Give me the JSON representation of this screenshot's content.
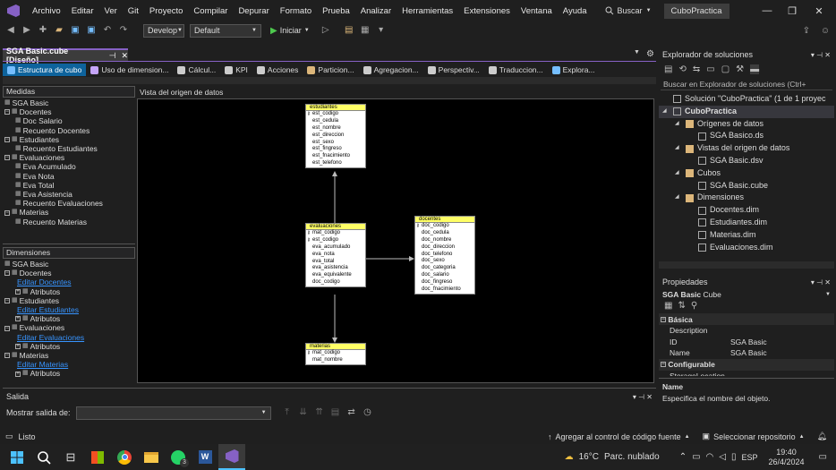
{
  "menu": {
    "items": [
      "Archivo",
      "Editar",
      "Ver",
      "Git",
      "Proyecto",
      "Compilar",
      "Depurar",
      "Formato",
      "Prueba",
      "Analizar",
      "Herramientas",
      "Extensiones",
      "Ventana",
      "Ayuda"
    ],
    "search_label": "Buscar",
    "project_name": "CuboPractica"
  },
  "toolbar": {
    "config": "Develop",
    "platform": "Default",
    "start_label": "Iniciar"
  },
  "document_tab": {
    "title": "SGA Basic.cube [Diseño]"
  },
  "designer_tabs": [
    "Estructura de cubo",
    "Uso de dimension...",
    "Cálcul...",
    "KPI",
    "Acciones",
    "Particion...",
    "Agregacion...",
    "Perspectiv...",
    "Traduccion...",
    "Explora..."
  ],
  "measures": {
    "header": "Medidas",
    "items": [
      {
        "text": "SGA Basic",
        "level": 0,
        "kind": "root"
      },
      {
        "text": "Docentes",
        "level": 0,
        "kind": "group"
      },
      {
        "text": "Doc Salario",
        "level": 1,
        "kind": "leaf"
      },
      {
        "text": "Recuento Docentes",
        "level": 1,
        "kind": "leaf"
      },
      {
        "text": "Estudiantes",
        "level": 0,
        "kind": "group"
      },
      {
        "text": "Recuento Estudiantes",
        "level": 1,
        "kind": "leaf"
      },
      {
        "text": "Evaluaciones",
        "level": 0,
        "kind": "group"
      },
      {
        "text": "Eva Acumulado",
        "level": 1,
        "kind": "leaf"
      },
      {
        "text": "Eva Nota",
        "level": 1,
        "kind": "leaf"
      },
      {
        "text": "Eva Total",
        "level": 1,
        "kind": "leaf"
      },
      {
        "text": "Eva Asistencia",
        "level": 1,
        "kind": "leaf"
      },
      {
        "text": "Recuento Evaluaciones",
        "level": 1,
        "kind": "leaf"
      },
      {
        "text": "Materias",
        "level": 0,
        "kind": "group"
      },
      {
        "text": "Recuento Materias",
        "level": 1,
        "kind": "leaf"
      }
    ]
  },
  "dimensions": {
    "header": "Dimensiones",
    "items": [
      {
        "text": "SGA Basic",
        "level": 0,
        "kind": "root"
      },
      {
        "text": "Docentes",
        "level": 0,
        "kind": "group"
      },
      {
        "text": "Editar Docentes",
        "level": 1,
        "kind": "link"
      },
      {
        "text": "Atributos",
        "level": 1,
        "kind": "attr"
      },
      {
        "text": "Estudiantes",
        "level": 0,
        "kind": "group"
      },
      {
        "text": "Editar Estudiantes",
        "level": 1,
        "kind": "link"
      },
      {
        "text": "Atributos",
        "level": 1,
        "kind": "attr"
      },
      {
        "text": "Evaluaciones",
        "level": 0,
        "kind": "group"
      },
      {
        "text": "Editar Evaluaciones",
        "level": 1,
        "kind": "link"
      },
      {
        "text": "Atributos",
        "level": 1,
        "kind": "attr"
      },
      {
        "text": "Materias",
        "level": 0,
        "kind": "group"
      },
      {
        "text": "Editar Materias",
        "level": 1,
        "kind": "link"
      },
      {
        "text": "Atributos",
        "level": 1,
        "kind": "attr"
      }
    ]
  },
  "dsv": {
    "header": "Vista del origen de datos",
    "tables": [
      {
        "name": "estudiantes",
        "columns": [
          "est_codigo",
          "est_cedula",
          "est_nombre",
          "est_direccion",
          "est_sexo",
          "est_fingreso",
          "est_fnacimiento",
          "est_telefono"
        ],
        "keys": [
          0
        ]
      },
      {
        "name": "evaluaciones",
        "columns": [
          "mat_codigo",
          "est_codigo",
          "eva_acumulado",
          "eva_nota",
          "eva_total",
          "eva_asistencia",
          "eva_equivalente",
          "doc_codigo"
        ],
        "keys": [
          0,
          1
        ]
      },
      {
        "name": "docentes",
        "columns": [
          "doc_codigo",
          "doc_cedula",
          "doc_nombre",
          "doc_direccion",
          "doc_telefono",
          "doc_sexo",
          "doc_categoria",
          "doc_salario",
          "doc_fingreso",
          "doc_fnacimiento"
        ],
        "keys": [
          0
        ]
      },
      {
        "name": "materias",
        "columns": [
          "mat_codigo",
          "mat_nombre"
        ],
        "keys": [
          0
        ]
      }
    ]
  },
  "output": {
    "title": "Salida",
    "show_label": "Mostrar salida de:",
    "show_value": ""
  },
  "solution_explorer": {
    "title": "Explorador de soluciones",
    "search_placeholder": "Buscar en Explorador de soluciones (Ctrl+",
    "items": [
      {
        "text": "Solución \"CuboPractica\" (1 de 1 proyec",
        "level": 0,
        "bold": false
      },
      {
        "text": "CuboPractica",
        "level": 0,
        "bold": true
      },
      {
        "text": "Orígenes de datos",
        "level": 1,
        "bold": false
      },
      {
        "text": "SGA Basico.ds",
        "level": 2,
        "bold": false
      },
      {
        "text": "Vistas del origen de datos",
        "level": 1,
        "bold": false
      },
      {
        "text": "SGA Basic.dsv",
        "level": 2,
        "bold": false
      },
      {
        "text": "Cubos",
        "level": 1,
        "bold": false
      },
      {
        "text": "SGA Basic.cube",
        "level": 2,
        "bold": false
      },
      {
        "text": "Dimensiones",
        "level": 1,
        "bold": false
      },
      {
        "text": "Docentes.dim",
        "level": 2,
        "bold": false
      },
      {
        "text": "Estudiantes.dim",
        "level": 2,
        "bold": false
      },
      {
        "text": "Materias.dim",
        "level": 2,
        "bold": false
      },
      {
        "text": "Evaluaciones.dim",
        "level": 2,
        "bold": false
      }
    ]
  },
  "properties": {
    "title": "Propiedades",
    "object_name": "SGA Basic",
    "object_type": "Cube",
    "section_basic": "Básica",
    "rows": [
      {
        "name": "Description",
        "value": ""
      },
      {
        "name": "ID",
        "value": "SGA Basic"
      },
      {
        "name": "Name",
        "value": "SGA Basic"
      }
    ],
    "section_config": "Configurable",
    "partial_row": "StorageLocation",
    "desc_title": "Name",
    "desc_text": "Especifica el nombre del objeto."
  },
  "status": {
    "ready": "Listo",
    "source_control": "Agregar al control de código fuente",
    "repo": "Seleccionar repositorio"
  },
  "taskbar": {
    "weather_temp": "16°C",
    "weather_desc": "Parc. nublado",
    "lang": "ESP",
    "time": "19:40",
    "date": "26/4/2024",
    "whatsapp_badge": "3"
  }
}
